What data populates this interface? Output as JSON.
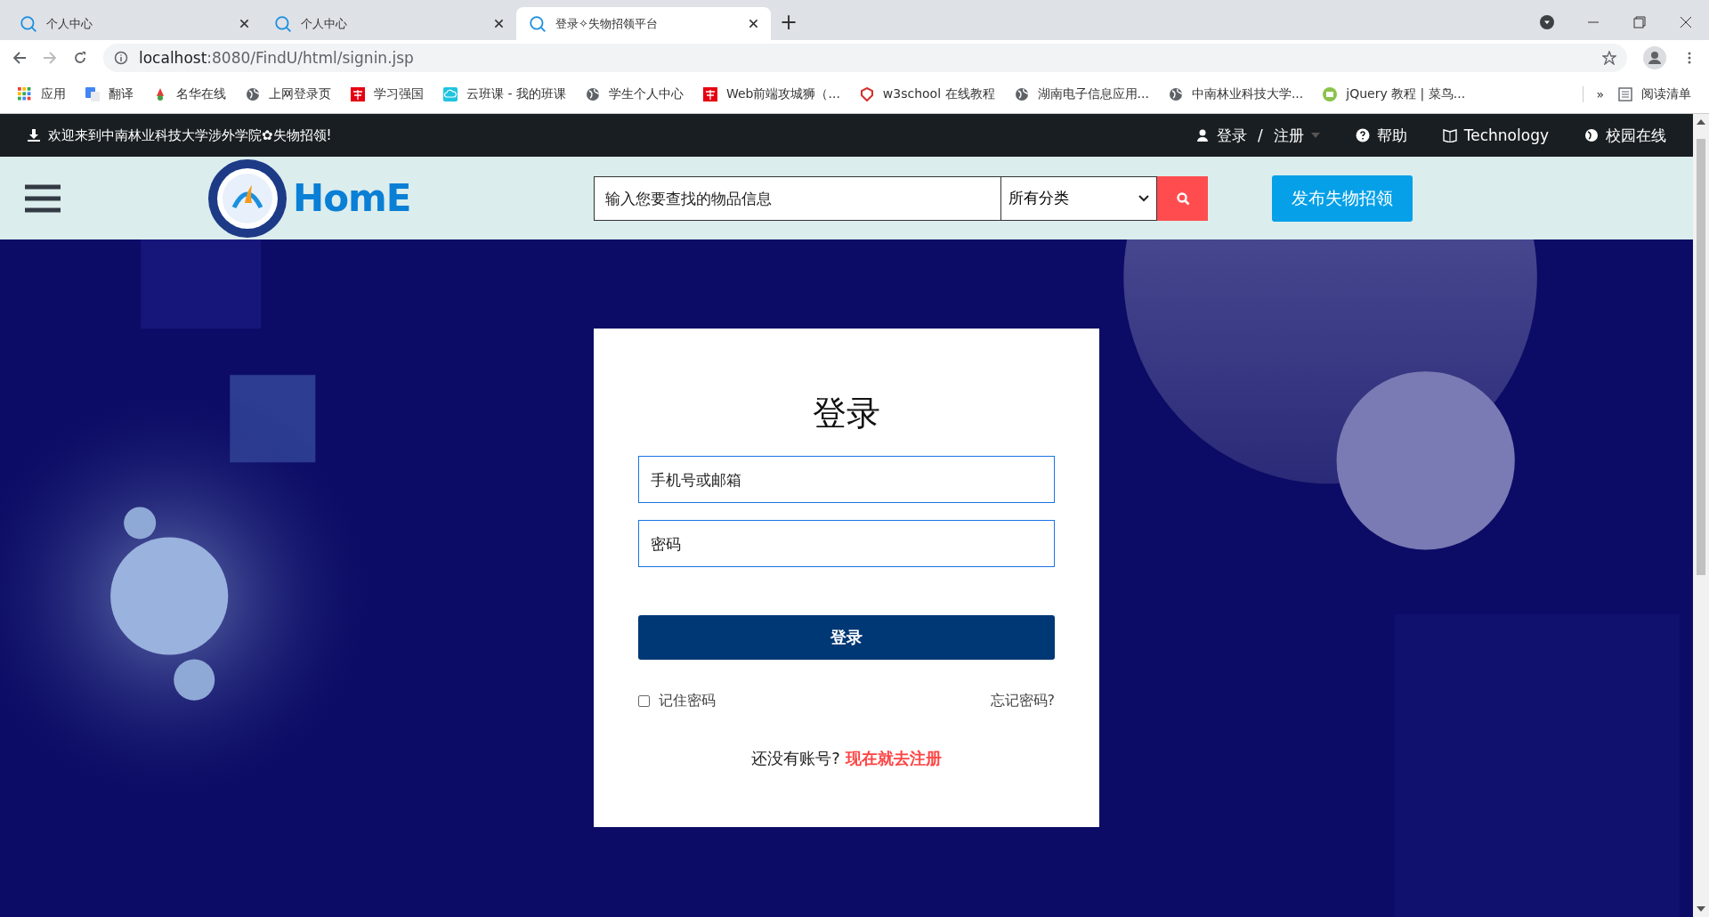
{
  "browser": {
    "tabs": [
      {
        "title": "个人中心",
        "selected": false
      },
      {
        "title": "个人中心",
        "selected": false
      },
      {
        "title": "登录✧失物招领平台",
        "selected": true
      }
    ],
    "new_tab": "+",
    "url_host": "localhost",
    "url_rest": ":8080/FindU/html/signin.jsp",
    "bookmarks": [
      {
        "label": "应用"
      },
      {
        "label": "翻译"
      },
      {
        "label": "名华在线"
      },
      {
        "label": "上网登录页"
      },
      {
        "label": "学习强国"
      },
      {
        "label": "云班课 - 我的班课"
      },
      {
        "label": "学生个人中心"
      },
      {
        "label": "Web前端攻城狮（..."
      },
      {
        "label": "w3school 在线教程"
      },
      {
        "label": "湖南电子信息应用..."
      },
      {
        "label": "中南林业科技大学..."
      },
      {
        "label": "jQuery 教程 | 菜鸟..."
      }
    ],
    "bookmarks_more": "»",
    "reading_list": "阅读清单"
  },
  "topbar": {
    "welcome": "欢迎来到中南林业科技大学涉外学院✿失物招领!",
    "login": "登录",
    "separator": "/",
    "register": "注册",
    "help": "帮助",
    "technology": "Technology",
    "campus": "校园在线"
  },
  "header": {
    "logo_text": "HomE",
    "search": {
      "placeholder": "输入您要查找的物品信息"
    },
    "category": "所有分类",
    "publish": "发布失物招领"
  },
  "login": {
    "title": "登录",
    "account": {
      "placeholder": "手机号或邮箱"
    },
    "password": {
      "placeholder": "密码"
    },
    "submit": "登录",
    "remember": {
      "label": "记住密码",
      "checked": false
    },
    "forgot": "忘记密码?",
    "prompt": "还没有账号?",
    "register_link": "现在就去注册"
  }
}
